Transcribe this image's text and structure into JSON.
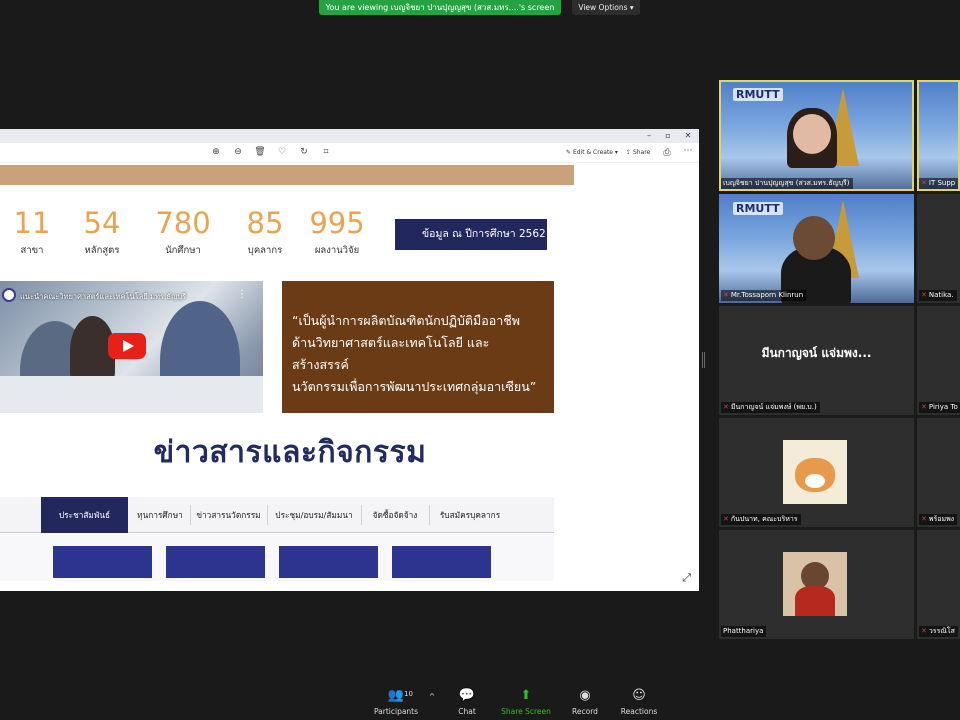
{
  "top": {
    "banner_text": "You are viewing เบญจิชยา ปานปุญญสุข (สวส.มทร....'s screen",
    "view_options": "View Options ▾"
  },
  "viewer": {
    "toolbar": {
      "edit_create": "Edit & Create",
      "share": "Share"
    },
    "stats": [
      {
        "value": "11",
        "label": "สาขา"
      },
      {
        "value": "54",
        "label": "หลักสูตร"
      },
      {
        "value": "780",
        "label": "นักศึกษา"
      },
      {
        "value": "85",
        "label": "บุคลากร"
      },
      {
        "value": "995",
        "label": "ผลงานวิจัย"
      }
    ],
    "info_button": "ข้อมูล ณ ปีการศึกษา 2562",
    "video_title": "แนะนำคณะวิทยาศาสตร์และเทคโนโลยี มทร.ธัญบุรี",
    "quote_lines": [
      "“เป็นผู้นำการผลิตบัณฑิตนักปฏิบัติมืออาชีพ",
      "ด้านวิทยาศาสตร์และเทคโนโลยี และสร้างสรรค์",
      "นวัตกรรมเพื่อการพัฒนาประเทศกลุ่มอาเซียน”"
    ],
    "news_heading": "ข่าวสารและกิจกรรม",
    "tabs": [
      "ประชาสัมพันธ์",
      "ทุนการศึกษา",
      "ข่าวสารนวัตกรรม",
      "ประชุม/อบรม/สัมมนา",
      "จัดซื้อจัดจ้าง",
      "รับสมัครบุคลากร"
    ],
    "active_tab": "ประชาสัมพันธ์"
  },
  "gallery": [
    {
      "name": "เบญจิชยา ปานปุญญสุข (สวส.มทร.ธัญบุรี)",
      "muted": false,
      "logo": "RMUTT",
      "active_speaker": true
    },
    {
      "name": "IT Supp",
      "muted": true,
      "logo": ""
    },
    {
      "name": "Mr.Tossaporn Klinrun",
      "muted": true,
      "logo": "RMUTT"
    },
    {
      "name": "Natika.",
      "muted": true
    },
    {
      "name": "มีนกาญจน์ แจ่มพงษ์ (พย.บ.)",
      "muted": true,
      "display": "มีนกาญจน์ แจ่มพง..."
    },
    {
      "name": "Piriya To",
      "muted": true
    },
    {
      "name": "กันปนาท, คณะบริหาร",
      "muted": true
    },
    {
      "name": "พร้อมพง",
      "muted": true
    },
    {
      "name": "Phatthariya",
      "muted": false
    },
    {
      "name": "วรรณิโส",
      "muted": true
    }
  ],
  "bottom_bar": {
    "participants": "Participants",
    "participants_count": "10",
    "chat": "Chat",
    "share_screen": "Share Screen",
    "record": "Record",
    "reactions": "Reactions"
  },
  "colors": {
    "zoom_green": "#27a243",
    "navy": "#22285e",
    "stat_orange": "#e9a352",
    "quote_brown": "#6b3b16",
    "active_speaker": "#e3d563"
  }
}
